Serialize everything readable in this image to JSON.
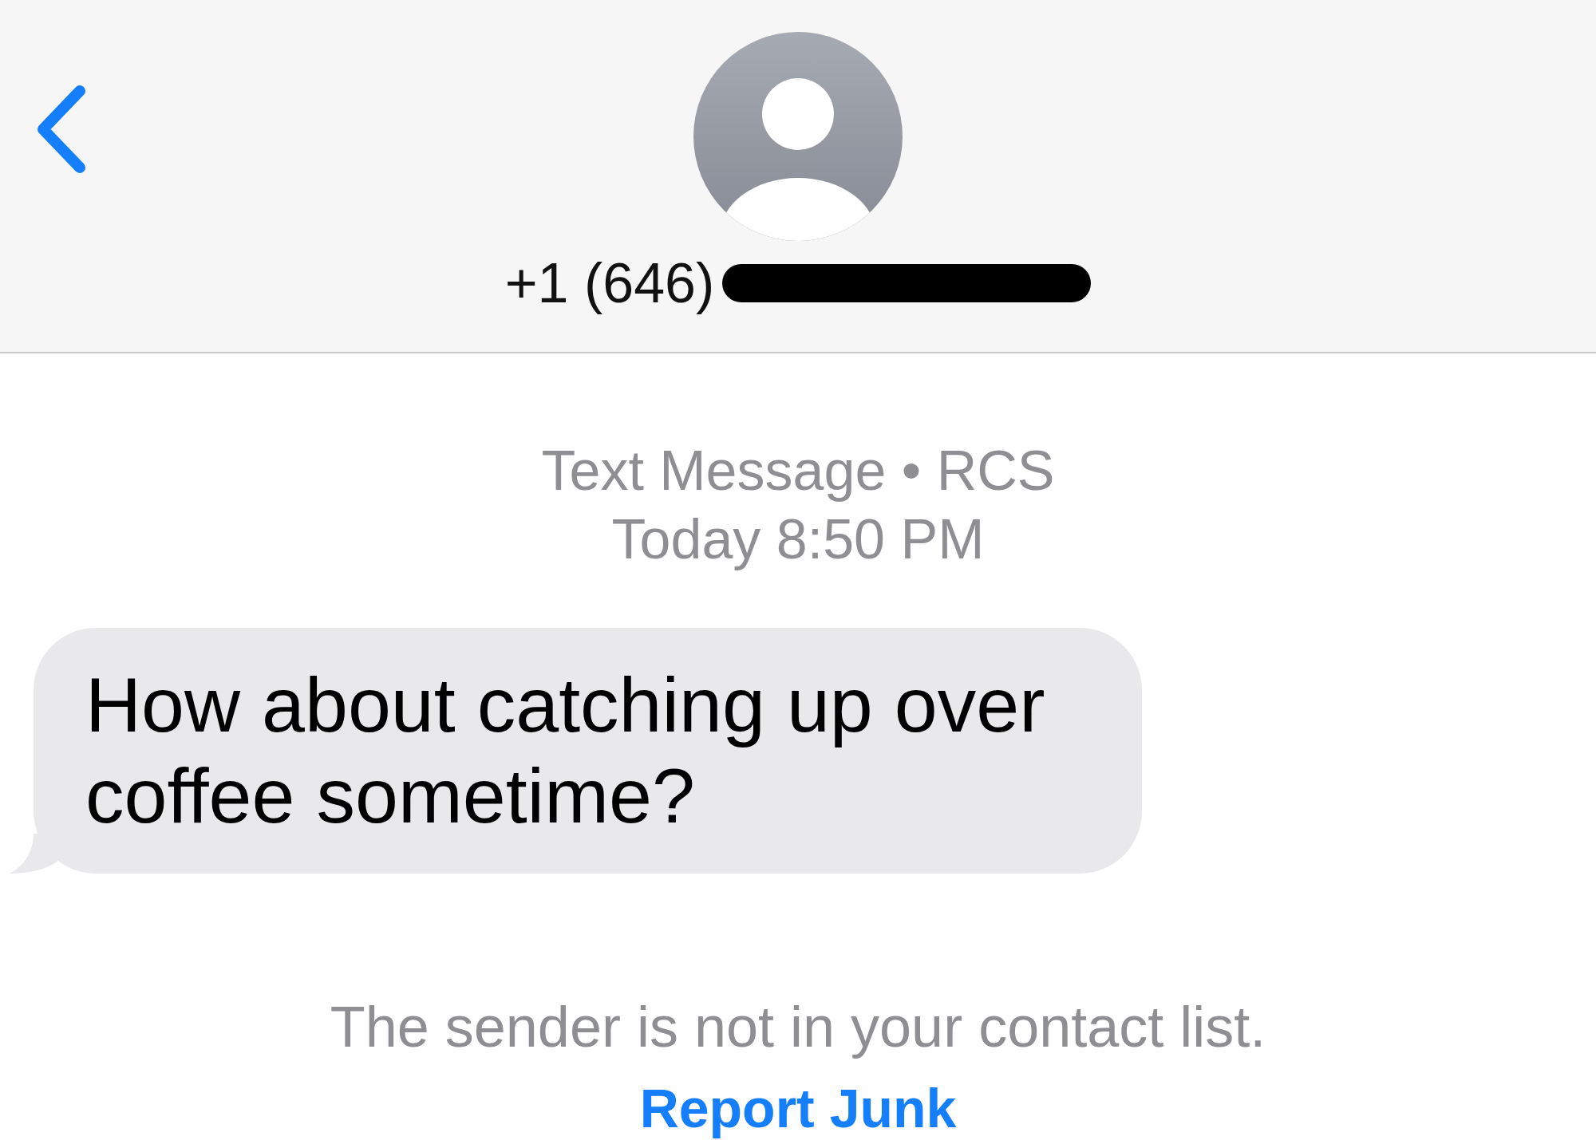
{
  "header": {
    "phone_number": "+1 (646)",
    "redacted": true
  },
  "conversation": {
    "service": "Text Message • RCS",
    "timestamp": "Today 8:50 PM"
  },
  "messages": [
    {
      "kind": "incoming",
      "text": "How about catching up over coffee sometime?"
    }
  ],
  "notice": {
    "text": "The sender is not in your contact list.",
    "action": "Report Junk"
  }
}
